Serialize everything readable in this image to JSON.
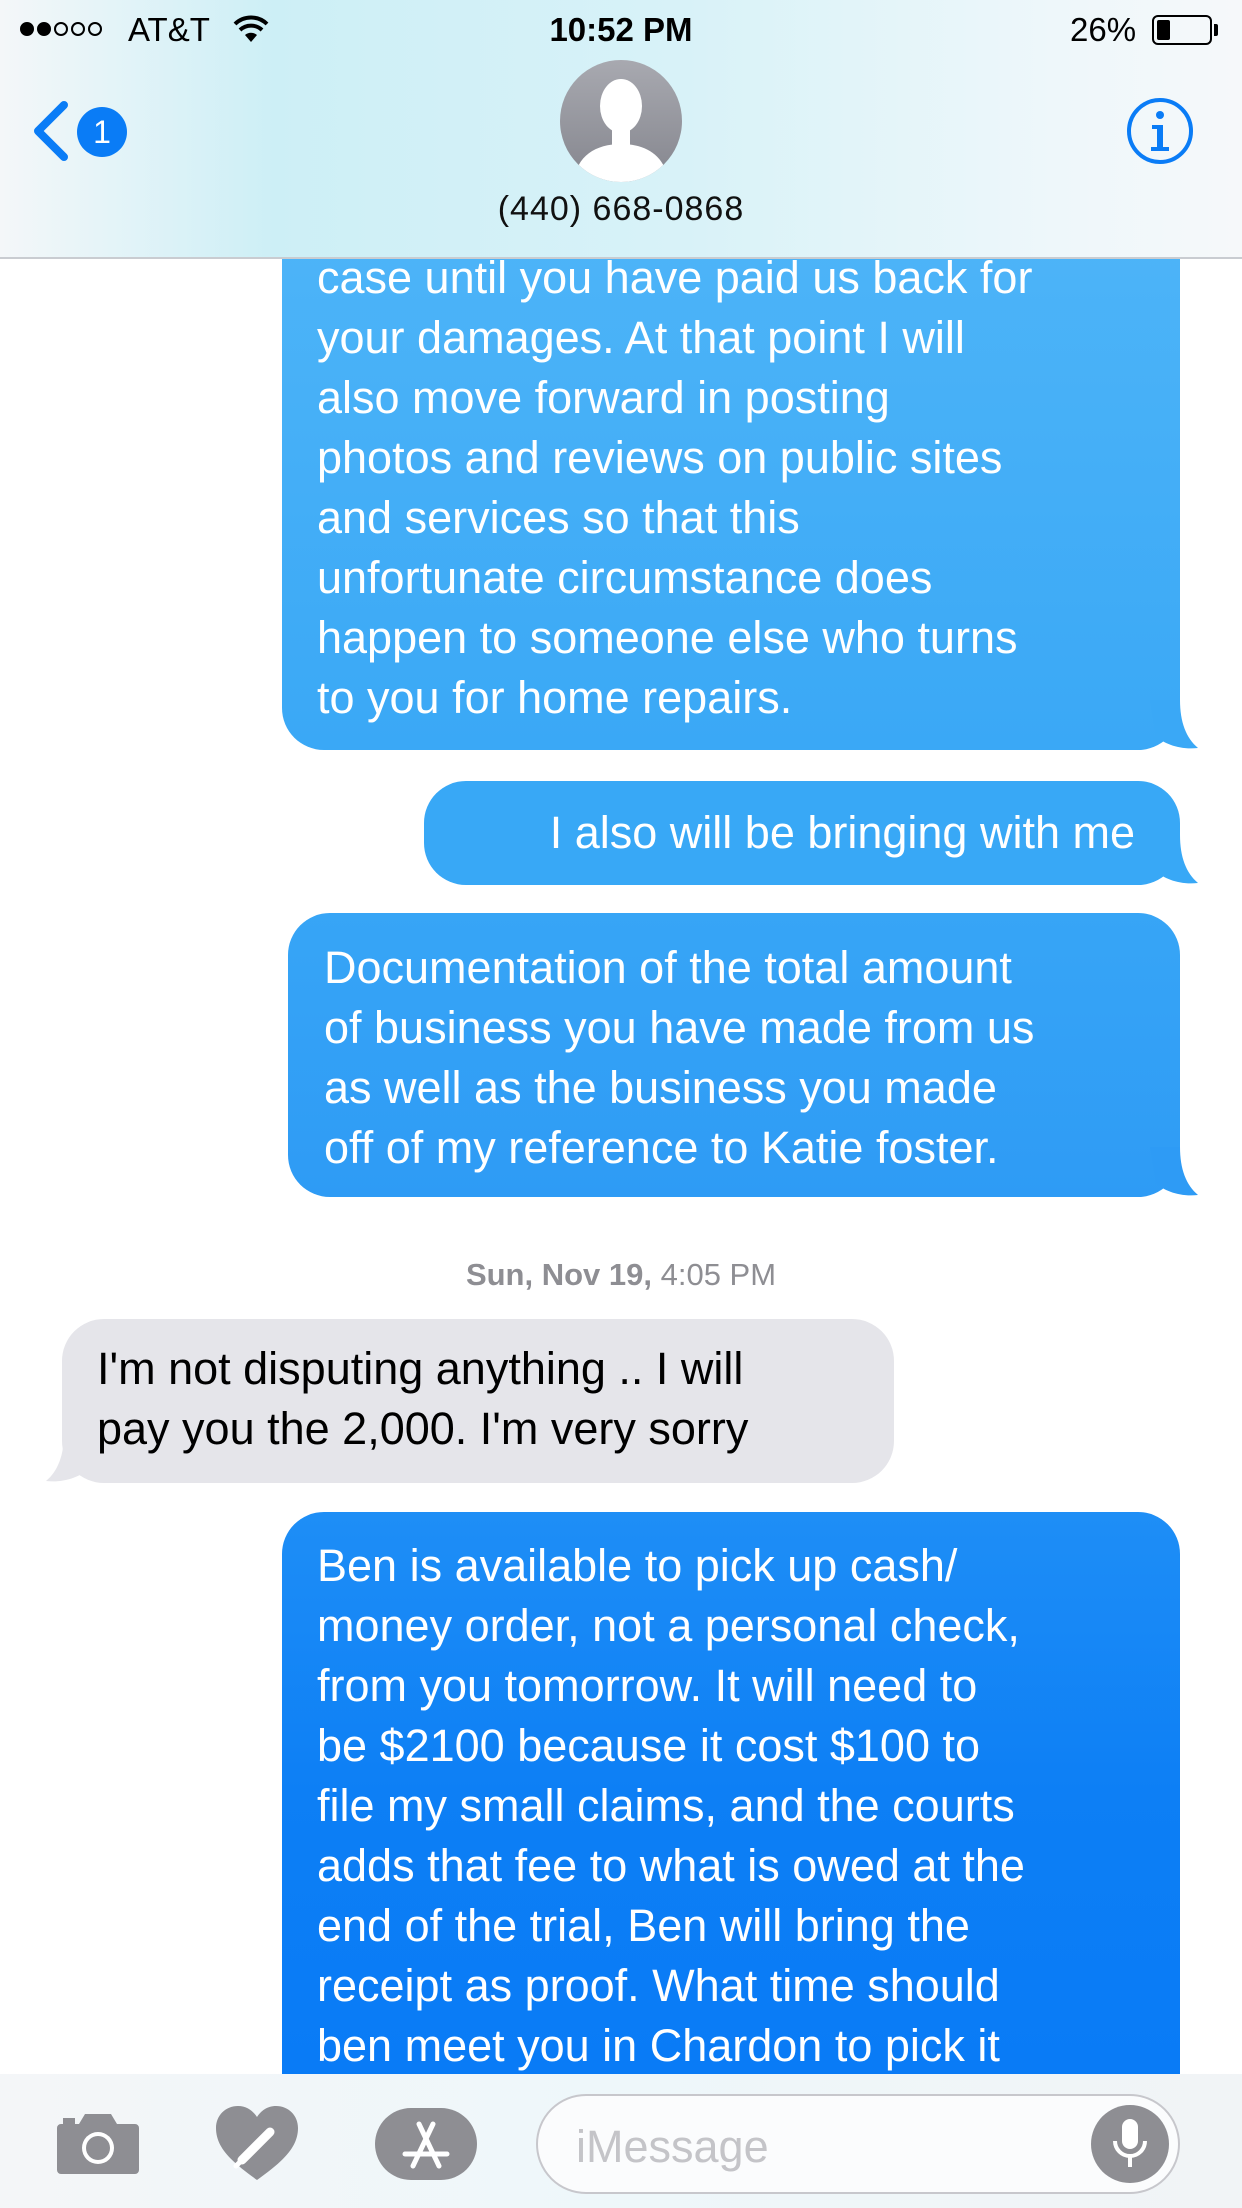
{
  "status_bar": {
    "carrier": "AT&T",
    "time": "10:52 PM",
    "battery_percent": "26%",
    "battery_level": 0.26,
    "signal_bars_filled": 2,
    "signal_bars_total": 5
  },
  "header": {
    "back_badge": "1",
    "contact_name": "(440) 668-0868",
    "accent_color": "#0a7cf6"
  },
  "messages": [
    {
      "direction": "outgoing",
      "lines": [
        "case until you have paid us back for",
        "your damages. At that point I will",
        "also move forward in posting",
        "photos and reviews on public sites",
        "and services so that this",
        "unfortunate circumstance does",
        "happen to someone else who turns",
        "to you for home repairs."
      ]
    },
    {
      "direction": "outgoing",
      "lines": [
        "I also will be bringing with me"
      ]
    },
    {
      "direction": "outgoing",
      "lines": [
        "Documentation of the total amount",
        "of business you have made from us",
        "as well as the business you made",
        "off of my reference to Katie foster."
      ]
    },
    {
      "direction": "incoming",
      "lines": [
        "I'm not disputing anything .. I will",
        "pay you the 2,000. I'm very sorry"
      ]
    },
    {
      "direction": "outgoing",
      "lines": [
        "Ben is available to pick up cash/",
        "money order, not a personal check,",
        "from you tomorrow. It will need to",
        "be $2100 because it cost $100 to",
        "file my small claims, and the courts",
        "adds that fee to what is owed at the",
        "end of the trial, Ben will bring the",
        "receipt as proof. What time should",
        "ben meet you in Chardon to pick it"
      ]
    }
  ],
  "timestamp": {
    "date": "Sun, Nov 19,",
    "time": "4:05 PM"
  },
  "input_bar": {
    "placeholder": "iMessage"
  }
}
